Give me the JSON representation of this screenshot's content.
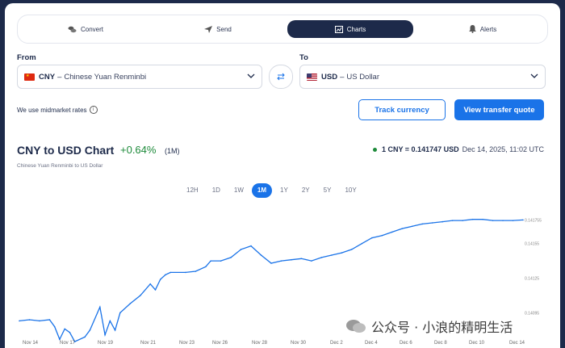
{
  "tabs": [
    {
      "label": "Convert",
      "icon": "convert-icon",
      "active": false
    },
    {
      "label": "Send",
      "icon": "send-icon",
      "active": false
    },
    {
      "label": "Charts",
      "icon": "charts-icon",
      "active": true
    },
    {
      "label": "Alerts",
      "icon": "bell-icon",
      "active": false
    }
  ],
  "from": {
    "label": "From",
    "code": "CNY",
    "separator": "–",
    "name": "Chinese Yuan Renminbi",
    "flag": "cn-flag"
  },
  "to": {
    "label": "To",
    "code": "USD",
    "separator": "–",
    "name": "US Dollar",
    "flag": "us-flag"
  },
  "note": "We use midmarket rates",
  "buttons": {
    "track": "Track currency",
    "quote": "View transfer quote"
  },
  "chart_header": {
    "title": "CNY to USD Chart",
    "change": "+0.64%",
    "period": "(1M)",
    "subtitle": "Chinese Yuan Renminbi to US Dollar",
    "rate_label": "1 CNY = 0.141747 USD",
    "rate_date": "Dec 14, 2025, 11:02 UTC"
  },
  "ranges": [
    "12H",
    "1D",
    "1W",
    "1M",
    "1Y",
    "2Y",
    "5Y",
    "10Y"
  ],
  "active_range": "1M",
  "watermark": "公众号 · 小浪的精明生活",
  "colors": {
    "accent": "#1a73e8",
    "navy": "#1d2a4a",
    "positive": "#1d8a3a",
    "line": "#1a73e8"
  },
  "chart_data": {
    "type": "line",
    "title": "CNY to USD Chart",
    "xlabel": "",
    "ylabel": "",
    "x_ticks": [
      "Nov 14",
      "Nov 17",
      "Nov 19",
      "Nov 21",
      "Nov 23",
      "Nov 26",
      "Nov 28",
      "Nov 30",
      "Dec 2",
      "Dec 4",
      "Dec 6",
      "Dec 8",
      "Dec 10",
      "Dec 14"
    ],
    "y_ticks": [
      "0.141755",
      "0.14155",
      "0.14125",
      "0.14095"
    ],
    "ylim": [
      0.14075,
      0.1418
    ],
    "x": [
      0,
      2,
      4,
      6,
      7,
      8,
      9,
      10,
      11,
      13,
      14,
      16,
      17,
      18,
      19,
      20,
      22,
      24,
      26,
      27,
      28,
      29,
      30,
      33,
      35,
      37,
      38,
      40,
      42,
      44,
      46,
      48,
      50,
      52,
      54,
      56,
      58,
      60,
      62,
      64,
      66,
      68,
      70,
      72,
      74,
      76,
      78,
      80,
      82,
      84,
      86,
      88,
      90,
      92,
      94,
      96,
      98,
      100
    ],
    "series": [
      {
        "values": [
          0.14088,
          0.14089,
          0.14088,
          0.14089,
          0.14083,
          0.14072,
          0.14081,
          0.14078,
          0.1407,
          0.14074,
          0.1408,
          0.141,
          0.14076,
          0.14088,
          0.1408,
          0.14095,
          0.14103,
          0.1411,
          0.1412,
          0.14115,
          0.14124,
          0.14128,
          0.1413,
          0.1413,
          0.14131,
          0.14135,
          0.1414,
          0.1414,
          0.14143,
          0.1415,
          0.14153,
          0.14145,
          0.14138,
          0.1414,
          0.14141,
          0.14142,
          0.1414,
          0.14143,
          0.14145,
          0.14147,
          0.1415,
          0.14155,
          0.1416,
          0.14162,
          0.14165,
          0.14168,
          0.1417,
          0.14172,
          0.14173,
          0.14174,
          0.14175,
          0.14175,
          0.14176,
          0.14176,
          0.14175,
          0.14175,
          0.14175,
          0.141755
        ]
      }
    ],
    "grid": false,
    "legend": "none"
  }
}
